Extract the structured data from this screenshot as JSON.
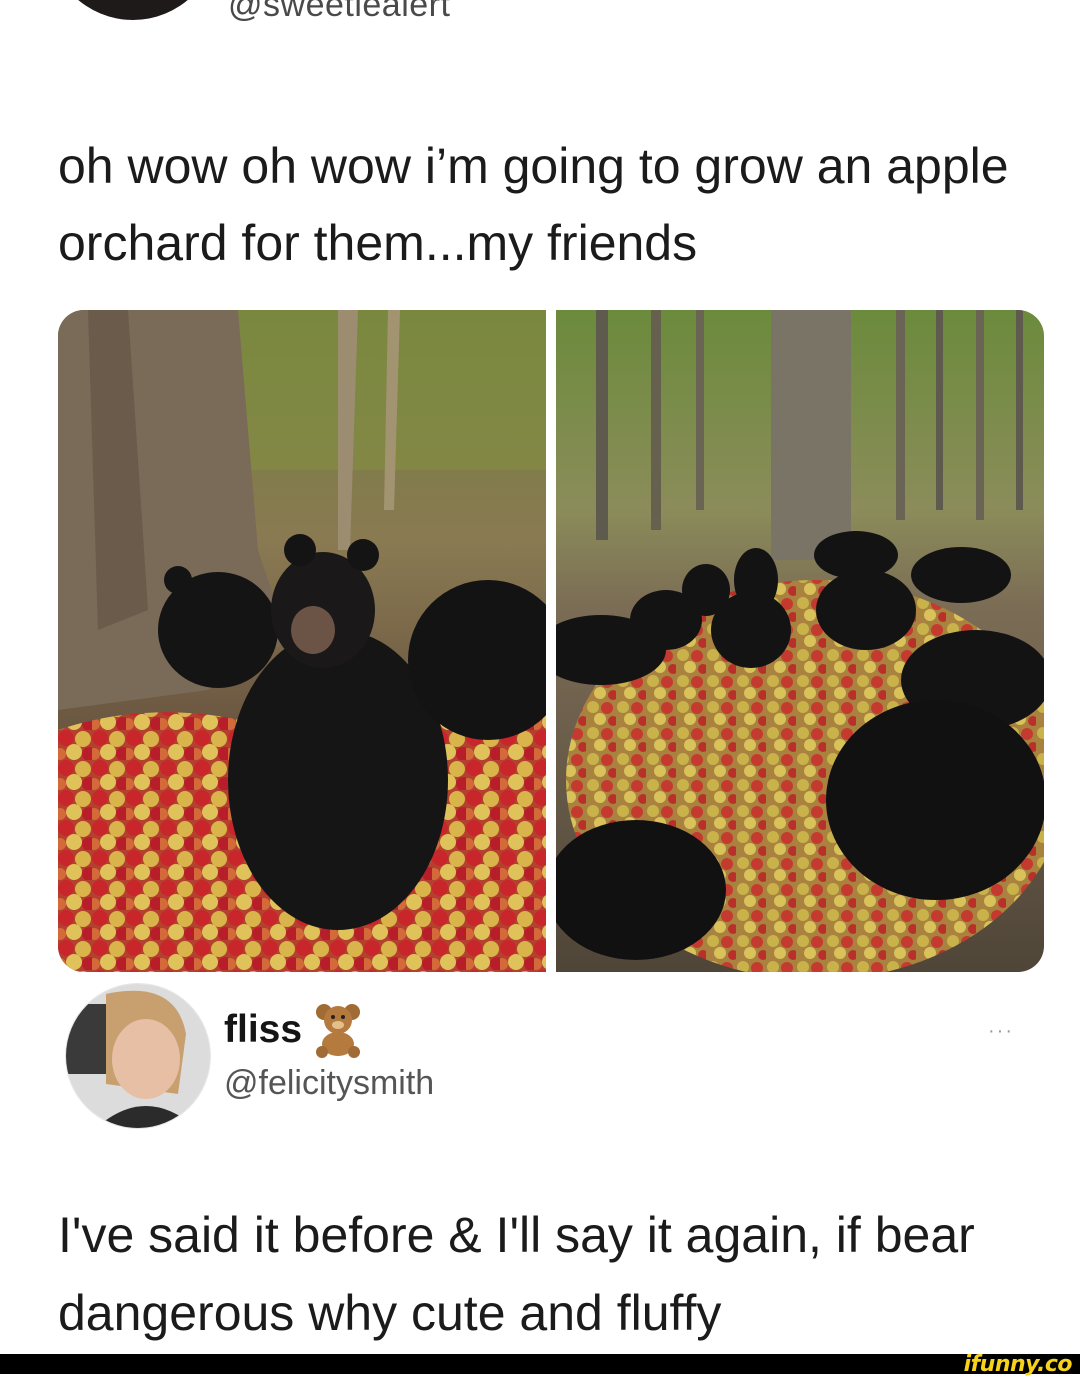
{
  "tweet1": {
    "handle": "@sweetiealert",
    "text": "oh wow oh wow i’m going to grow an apple orchard for them...my friends"
  },
  "tweet2": {
    "display_name": "fliss",
    "name_emoji_icon": "teddy-bear-icon",
    "handle": "@felicitysmith",
    "more_label": "···",
    "text": "I've said it before & I'll say it again, if bear dangerous why cute and fluffy"
  },
  "footer": {
    "logo": "ifunny.co"
  },
  "colors": {
    "background": "#ffffff",
    "text": "#1b1b1b",
    "handle": "#555555",
    "footer": "#000000",
    "logo": "#f7d21a"
  }
}
